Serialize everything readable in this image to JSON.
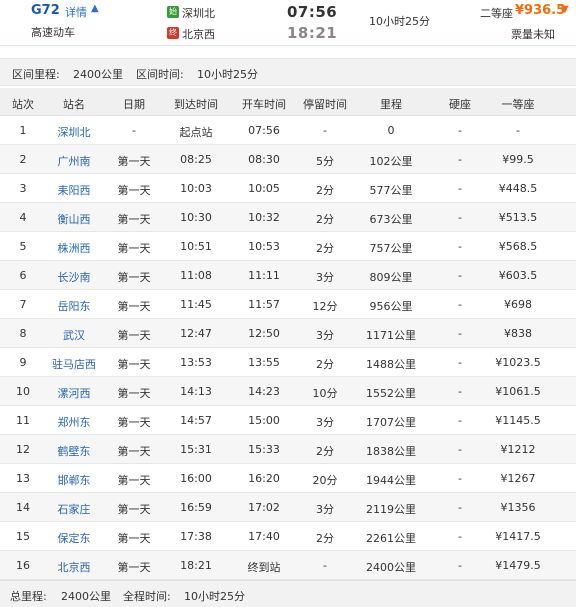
{
  "header": {
    "train_no": "G72",
    "detail_link": "详情",
    "detail_arrow": "▲",
    "train_type": "高速动车",
    "start_badge": "始",
    "end_badge": "终",
    "from_station": "深圳北",
    "to_station": "北京西",
    "dep_time": "07:56",
    "arr_time": "18:21",
    "duration": "10小时25分",
    "seat_type": "二等座",
    "seat_price": "¥936.5",
    "price_arrow": "▼",
    "ticket_status": "票量未知"
  },
  "interval": {
    "distance_label": "区间里程:",
    "distance_value": "2400公里",
    "time_label": "区间时间:",
    "time_value": "10小时25分"
  },
  "columns": [
    "站次",
    "站名",
    "日期",
    "到达时间",
    "开车时间",
    "停留时间",
    "里程",
    "硬座",
    "一等座"
  ],
  "stops": [
    {
      "no": "1",
      "station": "深圳北",
      "day": "-",
      "arrive": "起点站",
      "depart": "07:56",
      "stay": "-",
      "distance": "0",
      "hard_seat": "-",
      "first_class": "-"
    },
    {
      "no": "2",
      "station": "广州南",
      "day": "第一天",
      "arrive": "08:25",
      "depart": "08:30",
      "stay": "5分",
      "distance": "102公里",
      "hard_seat": "-",
      "first_class": "¥99.5"
    },
    {
      "no": "3",
      "station": "耒阳西",
      "day": "第一天",
      "arrive": "10:03",
      "depart": "10:05",
      "stay": "2分",
      "distance": "577公里",
      "hard_seat": "-",
      "first_class": "¥448.5"
    },
    {
      "no": "4",
      "station": "衡山西",
      "day": "第一天",
      "arrive": "10:30",
      "depart": "10:32",
      "stay": "2分",
      "distance": "673公里",
      "hard_seat": "-",
      "first_class": "¥513.5"
    },
    {
      "no": "5",
      "station": "株洲西",
      "day": "第一天",
      "arrive": "10:51",
      "depart": "10:53",
      "stay": "2分",
      "distance": "757公里",
      "hard_seat": "-",
      "first_class": "¥568.5"
    },
    {
      "no": "6",
      "station": "长沙南",
      "day": "第一天",
      "arrive": "11:08",
      "depart": "11:11",
      "stay": "3分",
      "distance": "809公里",
      "hard_seat": "-",
      "first_class": "¥603.5"
    },
    {
      "no": "7",
      "station": "岳阳东",
      "day": "第一天",
      "arrive": "11:45",
      "depart": "11:57",
      "stay": "12分",
      "distance": "956公里",
      "hard_seat": "-",
      "first_class": "¥698"
    },
    {
      "no": "8",
      "station": "武汉",
      "day": "第一天",
      "arrive": "12:47",
      "depart": "12:50",
      "stay": "3分",
      "distance": "1171公里",
      "hard_seat": "-",
      "first_class": "¥838"
    },
    {
      "no": "9",
      "station": "驻马店西",
      "day": "第一天",
      "arrive": "13:53",
      "depart": "13:55",
      "stay": "2分",
      "distance": "1488公里",
      "hard_seat": "-",
      "first_class": "¥1023.5"
    },
    {
      "no": "10",
      "station": "漯河西",
      "day": "第一天",
      "arrive": "14:13",
      "depart": "14:23",
      "stay": "10分",
      "distance": "1552公里",
      "hard_seat": "-",
      "first_class": "¥1061.5"
    },
    {
      "no": "11",
      "station": "郑州东",
      "day": "第一天",
      "arrive": "14:57",
      "depart": "15:00",
      "stay": "3分",
      "distance": "1707公里",
      "hard_seat": "-",
      "first_class": "¥1145.5"
    },
    {
      "no": "12",
      "station": "鹤壁东",
      "day": "第一天",
      "arrive": "15:31",
      "depart": "15:33",
      "stay": "2分",
      "distance": "1838公里",
      "hard_seat": "-",
      "first_class": "¥1212"
    },
    {
      "no": "13",
      "station": "邯郸东",
      "day": "第一天",
      "arrive": "16:00",
      "depart": "16:20",
      "stay": "20分",
      "distance": "1944公里",
      "hard_seat": "-",
      "first_class": "¥1267"
    },
    {
      "no": "14",
      "station": "石家庄",
      "day": "第一天",
      "arrive": "16:59",
      "depart": "17:02",
      "stay": "3分",
      "distance": "2119公里",
      "hard_seat": "-",
      "first_class": "¥1356"
    },
    {
      "no": "15",
      "station": "保定东",
      "day": "第一天",
      "arrive": "17:38",
      "depart": "17:40",
      "stay": "2分",
      "distance": "2261公里",
      "hard_seat": "-",
      "first_class": "¥1417.5"
    },
    {
      "no": "16",
      "station": "北京西",
      "day": "第一天",
      "arrive": "18:21",
      "depart": "终到站",
      "stay": "-",
      "distance": "2400公里",
      "hard_seat": "-",
      "first_class": "¥1479.5"
    }
  ],
  "footer": {
    "total_distance_label": "总里程:",
    "total_distance_value": "2400公里",
    "total_time_label": "全程时间:",
    "total_time_value": "10小时25分"
  },
  "colors": {
    "link_blue": "#2566b5",
    "price_orange": "#f26c0d",
    "start_green": "#3a9a34",
    "end_red": "#d13a2a"
  }
}
